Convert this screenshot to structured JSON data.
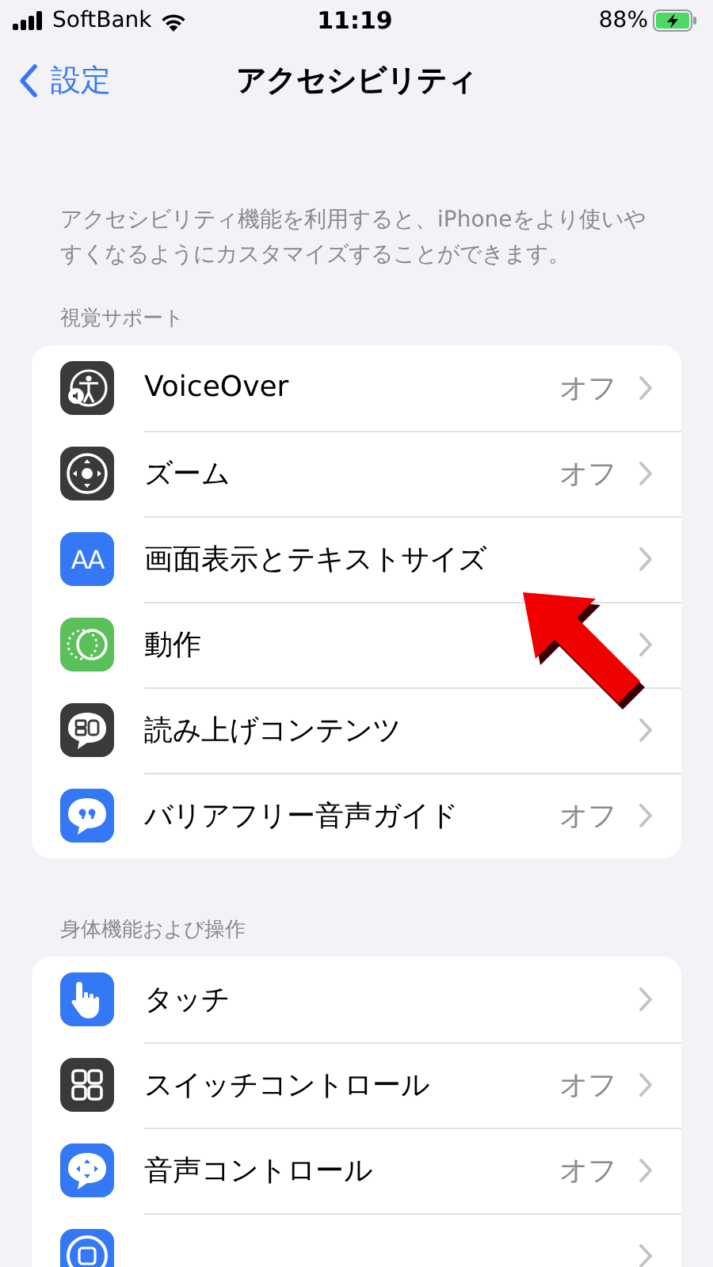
{
  "status_bar": {
    "carrier": "SoftBank",
    "time": "11:19",
    "battery": "88%",
    "charging": true
  },
  "nav": {
    "back": "設定",
    "title": "アクセシビリティ"
  },
  "description": "アクセシビリティ機能を利用すると、iPhoneをより使いやすくなるようにカスタマイズすることができます。",
  "sections": [
    {
      "header": "視覚サポート",
      "items": [
        {
          "label": "VoiceOver",
          "value": "オフ",
          "kind": "voiceover",
          "color": "#3a3a3c"
        },
        {
          "label": "ズーム",
          "value": "オフ",
          "kind": "zoom",
          "color": "#3a3a3c"
        },
        {
          "label": "画面表示とテキストサイズ",
          "kind": "text",
          "glyph": "AA",
          "color": "#3478f6"
        },
        {
          "label": "動作",
          "kind": "motion",
          "color": "#5ac05a"
        },
        {
          "label": "読み上げコンテンツ",
          "kind": "spoken",
          "color": "#3a3a3c"
        },
        {
          "label": "バリアフリー音声ガイド",
          "value": "オフ",
          "kind": "quote",
          "color": "#3478f6"
        }
      ]
    },
    {
      "header": "身体機能および操作",
      "items": [
        {
          "label": "タッチ",
          "kind": "touch",
          "color": "#3478f6"
        },
        {
          "label": "スイッチコントロール",
          "value": "オフ",
          "kind": "grid",
          "color": "#3a3a3c"
        },
        {
          "label": "音声コントロール",
          "value": "オフ",
          "kind": "voice",
          "color": "#3478f6"
        },
        {
          "kind": "home",
          "color": "#3478f6"
        }
      ]
    }
  ],
  "annotation": {
    "kind": "arrow"
  }
}
